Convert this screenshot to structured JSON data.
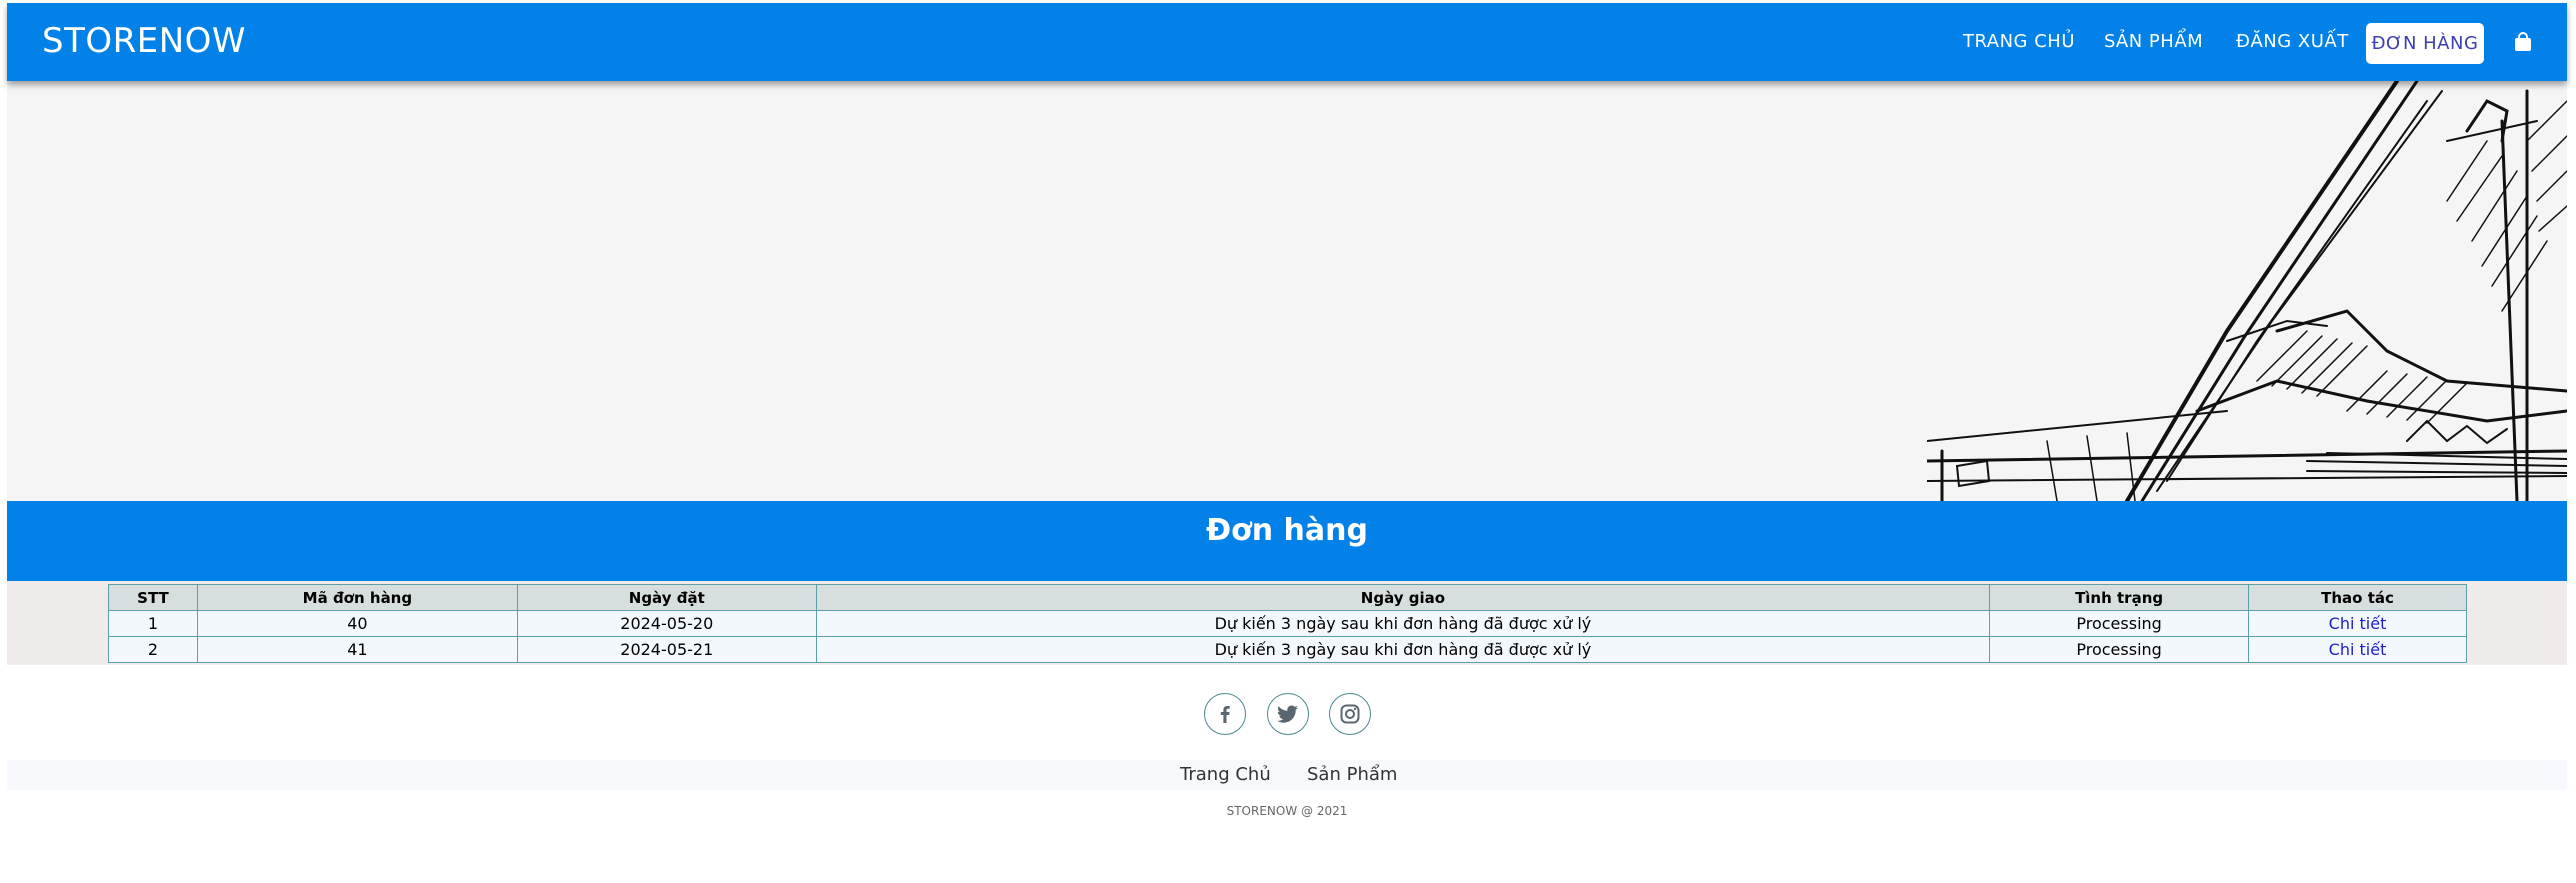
{
  "navbar": {
    "brand": "STORENOW",
    "links": [
      "TRANG CHỦ",
      "SẢN PHẨM",
      "ĐĂNG XUẤT"
    ],
    "active": "ĐƠN HÀNG",
    "cart_icon": "shopping-bag-icon"
  },
  "page": {
    "title": "Đơn hàng"
  },
  "orders": {
    "headers": [
      "STT",
      "Mã đơn hàng",
      "Ngày đặt",
      "Ngày giao",
      "Tình trạng",
      "Thao tác"
    ],
    "rows": [
      [
        "1",
        "40",
        "2024-05-20",
        "Dự kiến 3 ngày sau khi đơn hàng đã được xử lý",
        "Processing",
        "Chi tiết"
      ],
      [
        "2",
        "41",
        "2024-05-21",
        "Dự kiến 3 ngày sau khi đơn hàng đã được xử lý",
        "Processing",
        "Chi tiết"
      ]
    ]
  },
  "footer": {
    "social_icons": [
      "facebook-icon",
      "twitter-icon",
      "instagram-icon"
    ],
    "links": [
      "Trang Chủ",
      "Sản Phẩm"
    ],
    "copyright": "STORENOW @ 2021"
  },
  "colors": {
    "primary": "#0281e8",
    "active_text": "#3d3fb4",
    "link": "#1d1dc9"
  }
}
